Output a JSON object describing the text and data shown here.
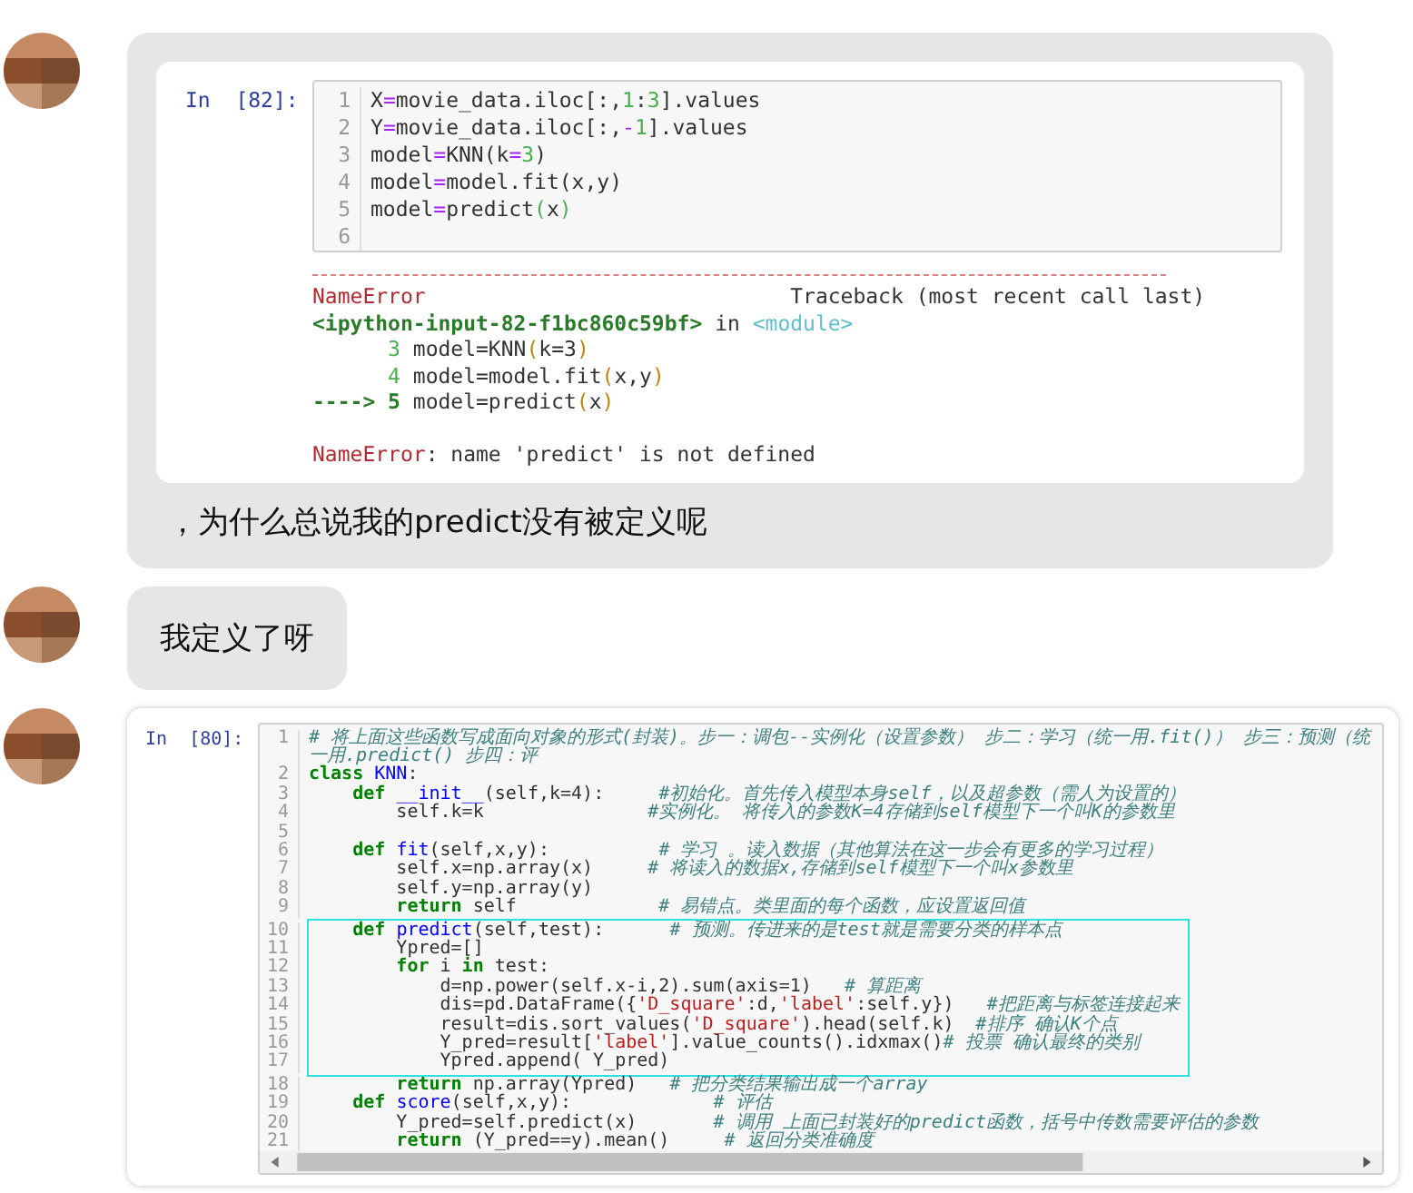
{
  "messages": [
    {
      "kind": "screenshot-text",
      "notebook": {
        "prompt": "In  [82]:",
        "blocks": [
          {
            "lines": [
              {
                "number": "1",
                "tokens": [
                  {
                    "kind": "plain",
                    "text": "X"
                  },
                  {
                    "kind": "operator",
                    "text": "="
                  },
                  {
                    "kind": "plain",
                    "text": "movie_data.iloc[:,"
                  },
                  {
                    "kind": "number",
                    "text": "1"
                  },
                  {
                    "kind": "plain",
                    "text": ":"
                  },
                  {
                    "kind": "number",
                    "text": "3"
                  },
                  {
                    "kind": "plain",
                    "text": "].values"
                  }
                ]
              },
              {
                "number": "2",
                "tokens": [
                  {
                    "kind": "plain",
                    "text": "Y"
                  },
                  {
                    "kind": "operator",
                    "text": "="
                  },
                  {
                    "kind": "plain",
                    "text": "movie_data.iloc[:,"
                  },
                  {
                    "kind": "operator",
                    "text": "-"
                  },
                  {
                    "kind": "number",
                    "text": "1"
                  },
                  {
                    "kind": "plain",
                    "text": "].values"
                  }
                ]
              },
              {
                "number": "3",
                "tokens": [
                  {
                    "kind": "plain",
                    "text": "model"
                  },
                  {
                    "kind": "operator",
                    "text": "="
                  },
                  {
                    "kind": "plain",
                    "text": "KNN(k"
                  },
                  {
                    "kind": "operator",
                    "text": "="
                  },
                  {
                    "kind": "number",
                    "text": "3"
                  },
                  {
                    "kind": "plain",
                    "text": ")"
                  }
                ]
              },
              {
                "number": "4",
                "tokens": [
                  {
                    "kind": "plain",
                    "text": "model"
                  },
                  {
                    "kind": "operator",
                    "text": "="
                  },
                  {
                    "kind": "plain",
                    "text": "model.fit(x,y)"
                  }
                ]
              },
              {
                "number": "5",
                "tokens": [
                  {
                    "kind": "plain",
                    "text": "model"
                  },
                  {
                    "kind": "operator",
                    "text": "="
                  },
                  {
                    "kind": "plain",
                    "text": "predict"
                  },
                  {
                    "kind": "number",
                    "text": "("
                  },
                  {
                    "kind": "plain",
                    "text": "x"
                  },
                  {
                    "kind": "number",
                    "text": ")"
                  }
                ]
              },
              {
                "number": "6"
              }
            ]
          }
        ],
        "output": [
          {
            "tokens": [
              {
                "kind": "error",
                "text": "NameError"
              },
              {
                "kind": "plain",
                "text": "                             Traceback (most recent call last)"
              }
            ]
          },
          {
            "tokens": [
              {
                "kind": "file",
                "text": "<ipython-input-82-f1bc860c59bf>"
              },
              {
                "kind": "plain",
                "text": " in "
              },
              {
                "kind": "module",
                "text": "<module>"
              }
            ]
          },
          {
            "tokens": [
              {
                "kind": "lineref",
                "text": "      3"
              },
              {
                "kind": "plain",
                "text": " model=KNN"
              },
              {
                "kind": "paren",
                "text": "("
              },
              {
                "kind": "plain",
                "text": "k=3"
              },
              {
                "kind": "paren",
                "text": ")"
              }
            ]
          },
          {
            "tokens": [
              {
                "kind": "lineref",
                "text": "      4"
              },
              {
                "kind": "plain",
                "text": " model=model.fit"
              },
              {
                "kind": "paren",
                "text": "("
              },
              {
                "kind": "plain",
                "text": "x,y"
              },
              {
                "kind": "paren",
                "text": ")"
              }
            ]
          },
          {
            "tokens": [
              {
                "kind": "file",
                "text": "----> 5"
              },
              {
                "kind": "plain",
                "text": " model=predict"
              },
              {
                "kind": "paren",
                "text": "("
              },
              {
                "kind": "plain",
                "text": "x"
              },
              {
                "kind": "paren",
                "text": ")"
              }
            ]
          },
          {
            "spaced": true,
            "tokens": [
              {
                "kind": "error",
                "text": "NameError"
              },
              {
                "kind": "plain",
                "text": ": name 'predict' is not defined"
              }
            ]
          }
        ]
      },
      "text": "，为什么总说我的predict没有被定义呢"
    },
    {
      "kind": "text",
      "text": "我定义了呀"
    },
    {
      "kind": "screenshot",
      "notebook": {
        "prompt": "In  [80]:",
        "blocks": [
          {
            "highlighted": false,
            "lines": [
              {
                "number": "1",
                "tokens": [
                  {
                    "kind": "comment",
                    "text": "# 将上面这些函数写成面向对象的形式(封装)。步一：调包--实例化（设置参数） 步二：学习（统一用.fit()） 步三：预测（统一用.predict() 步四：评"
                  }
                ]
              },
              {
                "number": "2",
                "tokens": [
                  {
                    "kind": "keyword",
                    "text": "class "
                  },
                  {
                    "kind": "name",
                    "text": "KNN"
                  },
                  {
                    "kind": "plain",
                    "text": ":"
                  }
                ]
              },
              {
                "number": "3",
                "tokens": [
                  {
                    "kind": "keyword",
                    "text": "    def "
                  },
                  {
                    "kind": "name",
                    "text": "__init__"
                  },
                  {
                    "kind": "plain",
                    "text": "(self,k=4):     "
                  },
                  {
                    "kind": "comment",
                    "text": "#初始化。首先传入模型本身self，以及超参数（需人为设置的）"
                  }
                ]
              },
              {
                "number": "4",
                "tokens": [
                  {
                    "kind": "plain",
                    "text": "        self.k=k               "
                  },
                  {
                    "kind": "comment",
                    "text": "#实例化。 将传入的参数K=4存储到self模型下一个叫K的参数里"
                  }
                ]
              },
              {
                "number": "5"
              },
              {
                "number": "6",
                "tokens": [
                  {
                    "kind": "keyword",
                    "text": "    def "
                  },
                  {
                    "kind": "name",
                    "text": "fit"
                  },
                  {
                    "kind": "plain",
                    "text": "(self,x,y):          "
                  },
                  {
                    "kind": "comment",
                    "text": "# 学习 。读入数据（其他算法在这一步会有更多的学习过程）"
                  }
                ]
              },
              {
                "number": "7",
                "tokens": [
                  {
                    "kind": "plain",
                    "text": "        self.x=np.array(x)     "
                  },
                  {
                    "kind": "comment",
                    "text": "# 将读入的数据x,存储到self模型下一个叫x参数里"
                  }
                ]
              },
              {
                "number": "8",
                "tokens": [
                  {
                    "kind": "plain",
                    "text": "        self.y=np.array(y)"
                  }
                ]
              },
              {
                "number": "9",
                "tokens": [
                  {
                    "kind": "keyword",
                    "text": "        return"
                  },
                  {
                    "kind": "plain",
                    "text": " self             "
                  },
                  {
                    "kind": "comment",
                    "text": "# 易错点。类里面的每个函数，应设置返回值"
                  }
                ]
              }
            ]
          },
          {
            "highlighted": true,
            "lines": [
              {
                "number": "10",
                "tokens": [
                  {
                    "kind": "keyword",
                    "text": "    def "
                  },
                  {
                    "kind": "name",
                    "text": "predict"
                  },
                  {
                    "kind": "plain",
                    "text": "(self,test):      "
                  },
                  {
                    "kind": "comment",
                    "text": "# 预测。传进来的是test就是需要分类的样本点"
                  }
                ]
              },
              {
                "number": "11",
                "tokens": [
                  {
                    "kind": "plain",
                    "text": "        Ypred=[]"
                  }
                ]
              },
              {
                "number": "12",
                "tokens": [
                  {
                    "kind": "keyword",
                    "text": "        for"
                  },
                  {
                    "kind": "plain",
                    "text": " i "
                  },
                  {
                    "kind": "keyword",
                    "text": "in"
                  },
                  {
                    "kind": "plain",
                    "text": " test:"
                  }
                ]
              },
              {
                "number": "13",
                "tokens": [
                  {
                    "kind": "plain",
                    "text": "            d=np.power(self.x-i,2).sum(axis=1)   "
                  },
                  {
                    "kind": "comment",
                    "text": "# 算距离"
                  }
                ]
              },
              {
                "number": "14",
                "tokens": [
                  {
                    "kind": "plain",
                    "text": "            dis=pd.DataFrame({"
                  },
                  {
                    "kind": "string",
                    "text": "'D_square'"
                  },
                  {
                    "kind": "plain",
                    "text": ":d,"
                  },
                  {
                    "kind": "string",
                    "text": "'label'"
                  },
                  {
                    "kind": "plain",
                    "text": ":self.y})   "
                  },
                  {
                    "kind": "comment",
                    "text": "#把距离与标签连接起来"
                  }
                ]
              },
              {
                "number": "15",
                "tokens": [
                  {
                    "kind": "plain",
                    "text": "            result=dis.sort_values("
                  },
                  {
                    "kind": "string",
                    "text": "'D_square'"
                  },
                  {
                    "kind": "plain",
                    "text": ").head(self.k)  "
                  },
                  {
                    "kind": "comment",
                    "text": "#排序 确认K个点"
                  }
                ]
              },
              {
                "number": "16",
                "tokens": [
                  {
                    "kind": "plain",
                    "text": "            Y_pred=result["
                  },
                  {
                    "kind": "string",
                    "text": "'label'"
                  },
                  {
                    "kind": "plain",
                    "text": "].value_counts().idxmax()"
                  },
                  {
                    "kind": "comment",
                    "text": "# 投票 确认最终的类别"
                  }
                ]
              },
              {
                "number": "17",
                "tokens": [
                  {
                    "kind": "plain",
                    "text": "            Ypred.append( Y_pred)"
                  }
                ]
              }
            ]
          },
          {
            "highlighted": false,
            "lines": [
              {
                "number": "18",
                "tokens": [
                  {
                    "kind": "keyword",
                    "text": "        return"
                  },
                  {
                    "kind": "plain",
                    "text": " np.array(Ypred)   "
                  },
                  {
                    "kind": "comment",
                    "text": "# 把分类结果输出成一个array"
                  }
                ]
              },
              {
                "number": "19",
                "tokens": [
                  {
                    "kind": "keyword",
                    "text": "    def "
                  },
                  {
                    "kind": "name",
                    "text": "score"
                  },
                  {
                    "kind": "plain",
                    "text": "(self,x,y):             "
                  },
                  {
                    "kind": "comment",
                    "text": "# 评估"
                  }
                ]
              },
              {
                "number": "20",
                "tokens": [
                  {
                    "kind": "plain",
                    "text": "        Y_pred=self.predict(x)       "
                  },
                  {
                    "kind": "comment",
                    "text": "# 调用 上面已封装好的predict函数，括号中传数需要评估的参数"
                  }
                ]
              },
              {
                "number": "21",
                "tokens": [
                  {
                    "kind": "keyword",
                    "text": "        return"
                  },
                  {
                    "kind": "plain",
                    "text": " (Y_pred==y).mean()     "
                  },
                  {
                    "kind": "comment",
                    "text": "# 返回分类准确度"
                  }
                ]
              }
            ]
          }
        ]
      }
    }
  ]
}
